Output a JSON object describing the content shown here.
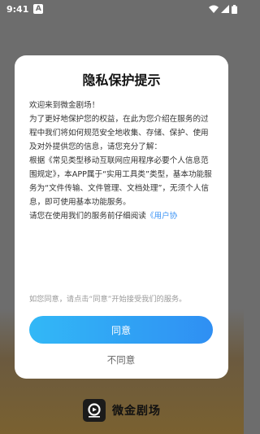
{
  "status_bar": {
    "time": "9:41",
    "notification_letter": "A",
    "icons": [
      "wifi-icon",
      "signal-icon",
      "battery-icon"
    ]
  },
  "dialog": {
    "title": "隐私保护提示",
    "paragraphs": [
      "欢迎来到微金剧场！",
      "为了更好地保护您的权益，在此为您介绍在服务的过程中我们将如何规范安全地收集、存储、保护、使用及对外提供您的信息，请您充分了解：",
      "根据《常见类型移动互联网应用程序必要个人信息范围规定》，本APP属于“实用工具类”类型，基本功能服务为“文件传输、文件管理、文档处理”，无须个人信息，即可使用基本功能服务。"
    ],
    "read_notice_prefix": "请您在使用我们的服务前仔细阅读",
    "read_notice_link": "《用户协",
    "hint": "如您同意，请点击“同意”开始接受我们的服务。",
    "agree_label": "同意",
    "disagree_label": "不同意"
  },
  "brand": {
    "name": "微金剧场",
    "logo_icon": "app-logo-icon"
  },
  "colors": {
    "accent_start": "#32b8f6",
    "accent_end": "#2f8ff3",
    "link": "#3b93f5",
    "overlay": "#6d6d6d"
  }
}
